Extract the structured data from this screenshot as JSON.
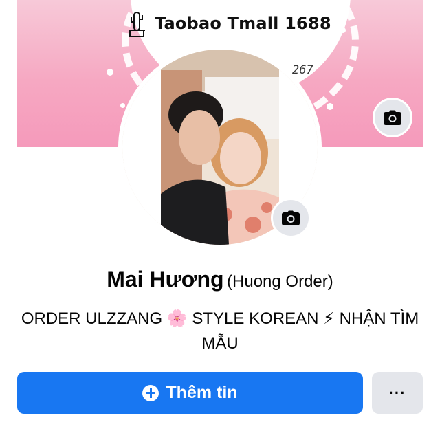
{
  "cover": {
    "brand_text": "Taobao Tmall 1688",
    "phone_fragment": "267",
    "bg_color": "#f6a8c2"
  },
  "profile": {
    "name": "Mai Hương",
    "alternate_name": "(Huong Order)",
    "bio": "ORDER ULZZANG 🌸 STYLE KOREAN ⚡ NHẬN TÌM MẪU"
  },
  "actions": {
    "add_story_label": "Thêm tin",
    "more_label": "···"
  },
  "icons": {
    "cover_camera": "camera-icon",
    "avatar_camera": "camera-icon",
    "add": "plus-circle-icon",
    "brand": "cactus-icon"
  },
  "colors": {
    "primary": "#1877f2",
    "secondary_button": "#e4e6eb"
  }
}
